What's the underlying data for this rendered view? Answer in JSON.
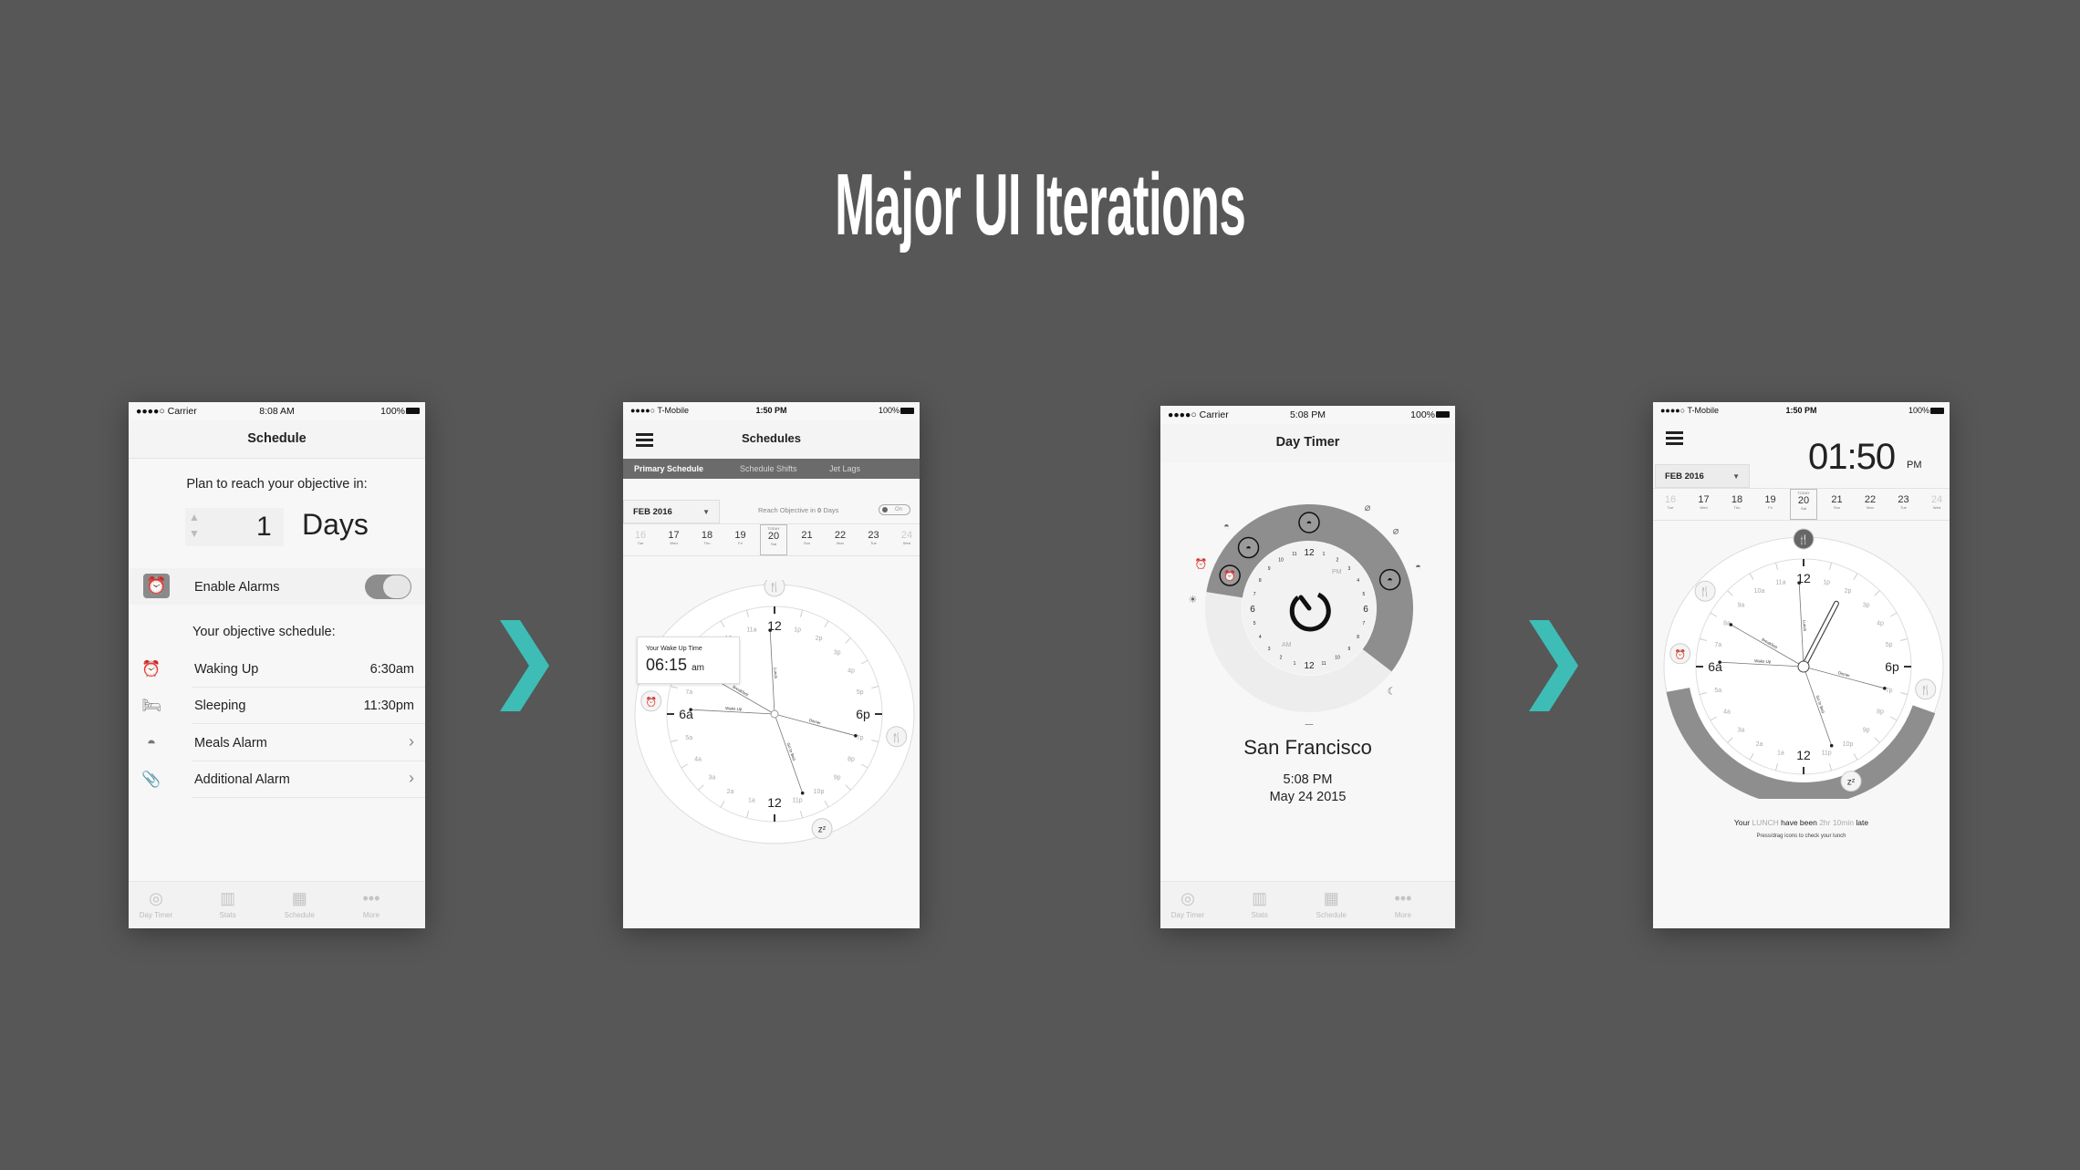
{
  "title": "Major UI Iterations",
  "colors": {
    "background": "#575757",
    "arrow": "#3dbdb6",
    "ring_dark": "#8e8e8e",
    "ring_light": "#ededed",
    "tab_bar": "#6b6b6b"
  },
  "phone1": {
    "status": {
      "carrier": "●●●●○ Carrier",
      "time": "8:08 AM",
      "battery": "100%"
    },
    "header_title": "Schedule",
    "plan_text": "Plan to reach your objective in:",
    "days_value": "1",
    "days_unit": "Days",
    "enable_alarms_label": "Enable Alarms",
    "enable_alarms_on": true,
    "objective_label": "Your objective schedule:",
    "rows": [
      {
        "icon": "alarm-clock-icon",
        "label": "Waking Up",
        "value": "6:30am"
      },
      {
        "icon": "bed-icon",
        "label": "Sleeping",
        "value": "11:30pm"
      },
      {
        "icon": "meal-cloche-icon",
        "label": "Meals Alarm",
        "value": "›"
      },
      {
        "icon": "paperclip-icon",
        "label": "Additional Alarm",
        "value": "›"
      }
    ],
    "tabbar": [
      {
        "icon": "day-timer-icon",
        "label": "Day Timer"
      },
      {
        "icon": "stats-icon",
        "label": "Stats"
      },
      {
        "icon": "schedule-icon",
        "label": "Schedule"
      },
      {
        "icon": "more-icon",
        "label": "More"
      }
    ]
  },
  "phone2": {
    "status": {
      "carrier": "●●●●○ T-Mobile",
      "time": "1:50 PM",
      "battery": "100%"
    },
    "header_title": "Schedules",
    "tabs": [
      "Primary Schedule",
      "Schedule Shifts",
      "Jet Lags"
    ],
    "active_tab": 0,
    "month": "FEB 2016",
    "reach_text": "Reach Objective in",
    "reach_days": "0",
    "reach_unit": "Days",
    "reach_toggle": "On",
    "today_label": "TODAY",
    "dates": [
      {
        "day": "16",
        "dow": "Tue"
      },
      {
        "day": "17",
        "dow": "Wed"
      },
      {
        "day": "18",
        "dow": "Thu"
      },
      {
        "day": "19",
        "dow": "Fri"
      },
      {
        "day": "20",
        "dow": "Sat"
      },
      {
        "day": "21",
        "dow": "Sun"
      },
      {
        "day": "22",
        "dow": "Mon"
      },
      {
        "day": "23",
        "dow": "Tue"
      },
      {
        "day": "24",
        "dow": "Wed"
      }
    ],
    "today_index": 4,
    "tooltip_label": "Your Wake Up Time",
    "tooltip_time": "06:15",
    "tooltip_ampm": "am"
  },
  "phone3": {
    "status": {
      "carrier": "●●●●○ Carrier",
      "time": "5:08 PM",
      "battery": "100%"
    },
    "header_title": "Day Timer",
    "pm_label": "PM",
    "am_label": "AM",
    "dial_labels": [
      "12",
      "1",
      "2",
      "3",
      "4",
      "5",
      "6",
      "7",
      "8",
      "9",
      "10",
      "11",
      "12",
      "1",
      "2",
      "3",
      "4",
      "5",
      "6",
      "7",
      "8",
      "9",
      "10",
      "11"
    ],
    "city": "San Francisco",
    "time": "5:08 PM",
    "date": "May 24 2015",
    "tabbar": [
      {
        "icon": "day-timer-icon",
        "label": "Day Timer"
      },
      {
        "icon": "stats-icon",
        "label": "Stats"
      },
      {
        "icon": "schedule-icon",
        "label": "Schedule"
      },
      {
        "icon": "more-icon",
        "label": "More"
      }
    ]
  },
  "phone4": {
    "status": {
      "carrier": "●●●●○ T-Mobile",
      "time": "1:50 PM",
      "battery": "100%"
    },
    "clock_time": "01:50",
    "clock_ampm": "PM",
    "month": "FEB 2016",
    "message_prefix": "Your",
    "message_meal": "LUNCH",
    "message_mid": "have been",
    "message_delay": "2hr 10min",
    "message_suffix": "late",
    "hint": "Press/drag icons to check your lunch"
  },
  "clock": {
    "hour_labels": [
      "12",
      "1p",
      "2p",
      "3p",
      "4p",
      "5p",
      "6p",
      "7p",
      "8p",
      "9p",
      "10p",
      "11p",
      "12",
      "1a",
      "2a",
      "3a",
      "4a",
      "5a",
      "6a",
      "7a",
      "8a",
      "9a",
      "10a",
      "11a"
    ],
    "arrows": [
      {
        "label": "Wake Up",
        "time": 6.2
      },
      {
        "label": "Breakfast",
        "time": 8.0
      },
      {
        "label": "Lunch",
        "time": 11.8
      },
      {
        "label": "Dinner",
        "time": 19.0
      },
      {
        "label": "Go to Bed",
        "time": 22.7
      }
    ],
    "hand_time": 13.83
  }
}
